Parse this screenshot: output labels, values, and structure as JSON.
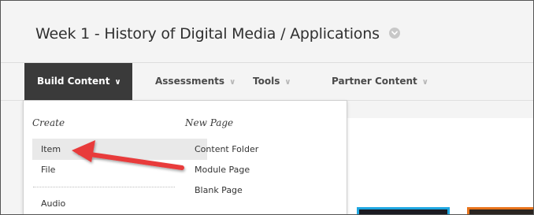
{
  "header": {
    "title": "Week 1 - History of Digital Media / Applications"
  },
  "menubar": {
    "items": [
      {
        "label": "Build Content",
        "active": true
      },
      {
        "label": "Assessments",
        "active": false
      },
      {
        "label": "Tools",
        "active": false
      },
      {
        "label": "Partner Content",
        "active": false
      }
    ]
  },
  "dropdown": {
    "create": {
      "heading": "Create",
      "items": [
        "Item",
        "File",
        "Audio"
      ],
      "highlighted": "Item"
    },
    "new_page": {
      "heading": "New Page",
      "items": [
        "Content Folder",
        "Module Page",
        "Blank Page"
      ]
    }
  },
  "icons": {
    "title_menu": "chevron-circle-down-icon",
    "menu_chevron": "chevron-down-icon",
    "annotation": "red-arrow-icon"
  },
  "colors": {
    "active_menu_bg": "#3a3a3a",
    "arrow": "#e83a3a",
    "thumb1_border": "#1ea7e1",
    "thumb2_border": "#e8741c"
  }
}
